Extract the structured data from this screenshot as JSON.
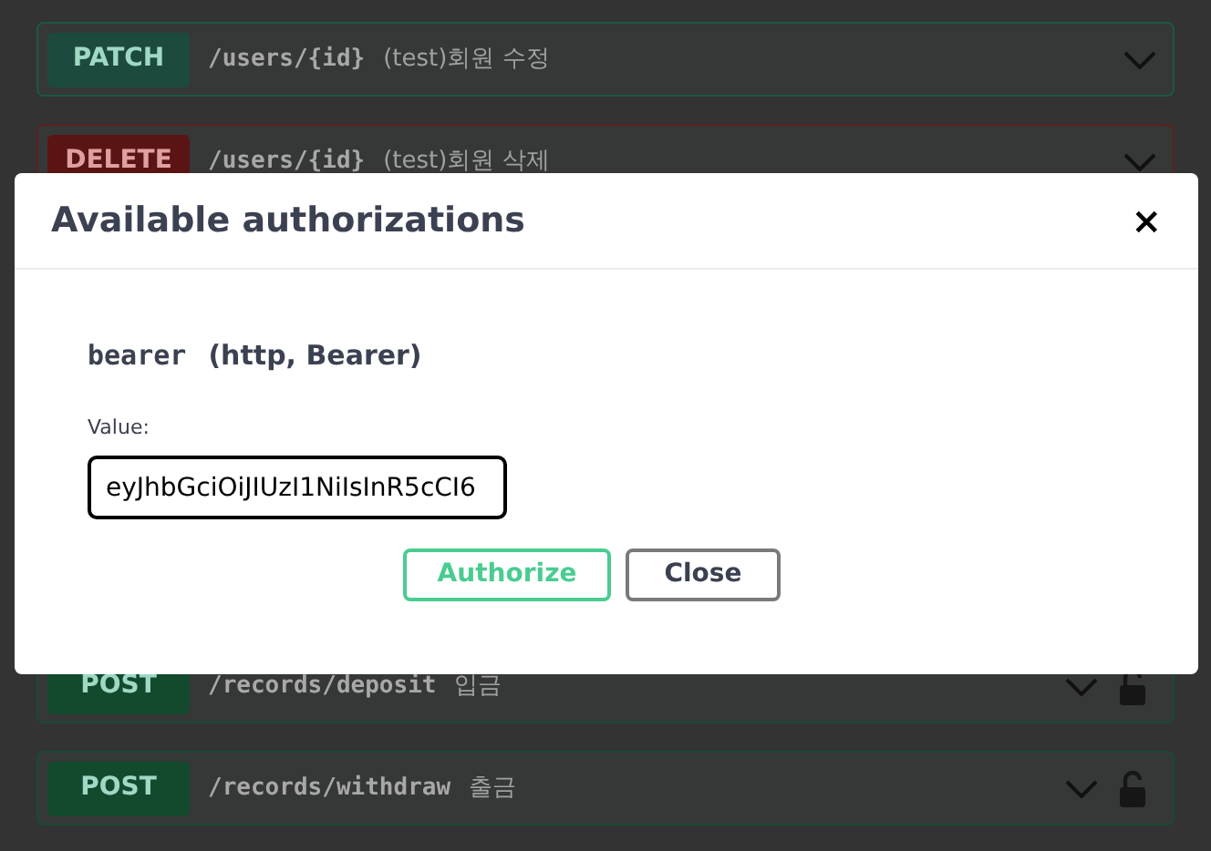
{
  "operations": [
    {
      "method": "PATCH",
      "color": "#1c4a3f",
      "path": "/users/{id}",
      "summary": "(test)회원 수정"
    },
    {
      "method": "DELETE",
      "color": "#5a1414",
      "path": "/users/{id}",
      "summary": "(test)회원 삭제"
    },
    {
      "method": "POST",
      "color": "#134a2e",
      "path": "/records/deposit",
      "summary": "입금",
      "locked": false
    },
    {
      "method": "POST",
      "color": "#134a2e",
      "path": "/records/withdraw",
      "summary": "출금",
      "locked": false
    }
  ],
  "dialog": {
    "title": "Available authorizations",
    "close_icon": "×",
    "scheme_name": "bearer",
    "scheme_type": "(http, Bearer)",
    "value_label": "Value:",
    "value": "eyJhbGciOiJIUzI1NiIsInR5cCI6",
    "buttons": [
      {
        "label": "Authorize",
        "kind": "primary"
      },
      {
        "label": "Close",
        "kind": "secondary"
      }
    ]
  }
}
